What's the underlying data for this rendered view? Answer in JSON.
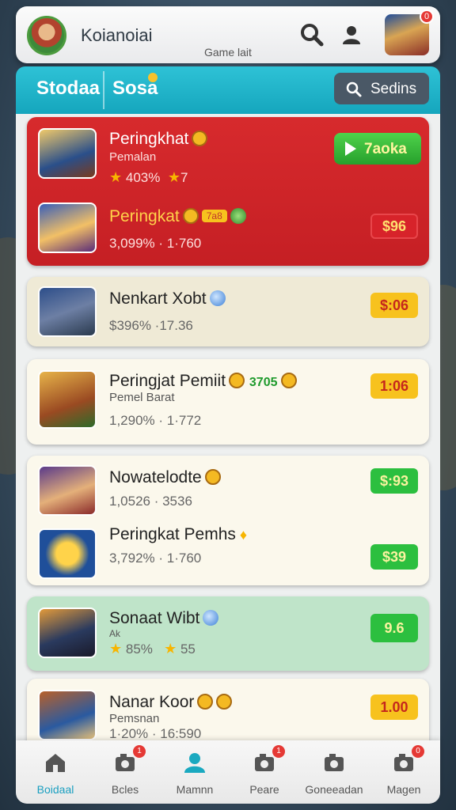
{
  "header": {
    "title": "Koianoiai",
    "subtitle": "Game lait",
    "profile_badge": "0"
  },
  "tabs": {
    "tab1": "Stodaa",
    "tab2": "Sosa",
    "search_label": "Sedins"
  },
  "items": [
    {
      "name": "Peringkhat",
      "sub": "Pemalan",
      "meta_left": "403%",
      "meta_right": "7",
      "action": "7aoka",
      "style": "red"
    },
    {
      "name": "Peringkat",
      "tag": "7a8",
      "meta": "3,099% · 1·760",
      "price": "$96",
      "style": "red"
    },
    {
      "name": "Nenkart Xobt",
      "meta": "$396% ·17.36",
      "price": "$:06",
      "price_color": "yellow"
    },
    {
      "name": "Peringjat Pemiit",
      "name_extra": "3705",
      "sub": "Pemel Barat",
      "meta": "1,290% · 1·772",
      "price": "1:06",
      "price_color": "yellow"
    },
    {
      "name": "Nowatelodte",
      "meta": "1,0526 · 3536",
      "price": "$:93",
      "price_color": "green"
    },
    {
      "name": "Peringkat Pemhs",
      "meta": "3,792% · 1·760",
      "price": "$39",
      "price_color": "green"
    },
    {
      "name": "Sonaat Wibt",
      "sub": "Ak",
      "meta_left": "85%",
      "meta_right": "55",
      "price": "9.6",
      "price_color": "green"
    },
    {
      "name": "Nanar Koor",
      "sub": "Pemsnan",
      "meta": "1·20% · 16:590",
      "price": "1.00",
      "price_color": "yellow"
    }
  ],
  "nav": [
    {
      "label": "Boidaal",
      "icon": "home-icon",
      "badge": ""
    },
    {
      "label": "Bcles",
      "icon": "camera-icon",
      "badge": "1"
    },
    {
      "label": "Mamnn",
      "icon": "user-icon",
      "badge": ""
    },
    {
      "label": "Peare",
      "icon": "camera-icon",
      "badge": "1"
    },
    {
      "label": "Goneeadan",
      "icon": "camera-icon",
      "badge": ""
    },
    {
      "label": "Magen",
      "icon": "camera-icon",
      "badge": "0"
    }
  ],
  "colors": {
    "accent": "#1aa9c0",
    "highlight_red": "#d72a2d",
    "price_yellow": "#f7c21e",
    "price_green": "#2cbf3f"
  }
}
